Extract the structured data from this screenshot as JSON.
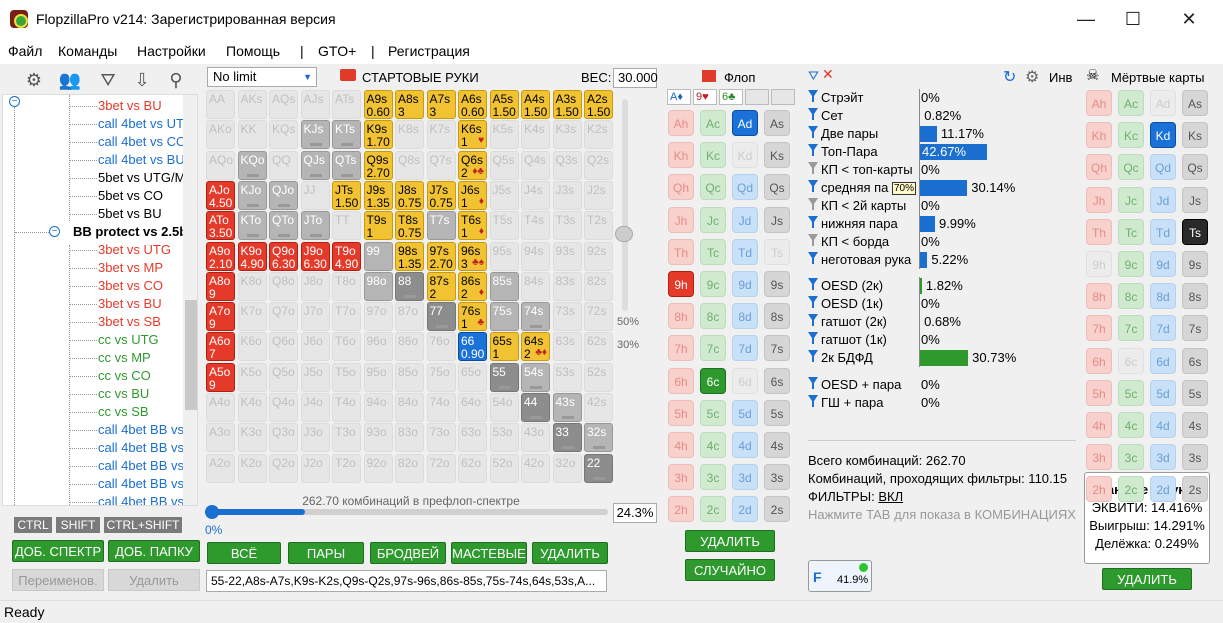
{
  "window": {
    "title": "FlopzillaPro v214: Зарегистрированная версия",
    "min": "—",
    "max": "☐",
    "close": "✕"
  },
  "menu": [
    "Файл",
    "Команды",
    "Настройки",
    "Помощь",
    "|",
    "GTO+",
    "|",
    "Регистрация"
  ],
  "tree": [
    {
      "label": "3bet vs BU",
      "color": "red"
    },
    {
      "label": "call 4bet vs UTG/",
      "color": "blue"
    },
    {
      "label": "call 4bet vs CO",
      "color": "blue"
    },
    {
      "label": "call 4bet vs BU",
      "color": "blue"
    },
    {
      "label": "5bet vs UTG/MP",
      "color": "black"
    },
    {
      "label": "5bet vs CO",
      "color": "black"
    },
    {
      "label": "5bet vs BU",
      "color": "black"
    },
    {
      "label": "BB protect vs 2.5bb",
      "color": "bold"
    },
    {
      "label": "3bet vs UTG",
      "color": "red"
    },
    {
      "label": "3bet vs MP",
      "color": "red"
    },
    {
      "label": "3bet vs CO",
      "color": "red"
    },
    {
      "label": "3bet vs BU",
      "color": "red"
    },
    {
      "label": "3bet vs SB",
      "color": "red"
    },
    {
      "label": "cc vs UTG",
      "color": "green"
    },
    {
      "label": "cc vs MP",
      "color": "green"
    },
    {
      "label": "cc vs CO",
      "color": "green"
    },
    {
      "label": "cc vs BU",
      "color": "green"
    },
    {
      "label": "cc vs SB",
      "color": "green"
    },
    {
      "label": "call 4bet BB vs U",
      "color": "blue"
    },
    {
      "label": "call 4bet BB vs M",
      "color": "blue"
    },
    {
      "label": "call 4bet BB vs C",
      "color": "blue"
    },
    {
      "label": "call 4bet BB vs B",
      "color": "blue"
    },
    {
      "label": "call 4bet BB vs S",
      "color": "blue"
    }
  ],
  "keys": {
    "ctrl": "CTRL",
    "shift": "SHIFT",
    "ctrlshift": "CTRL+SHIFT"
  },
  "leftbtns": {
    "add_range": "ДОБ. СПЕКТР",
    "add_folder": "ДОБ. ПАПКУ",
    "rename": "Переименов.",
    "delete": "Удалить"
  },
  "range": {
    "limit": "No limit",
    "title": "СТАРТОВЫЕ РУКИ",
    "weight_label": "ВЕС:",
    "weight": "30.000",
    "pct50": "50%",
    "pct30": "30%",
    "combos_text": "262.70 комбинаций в префлоп-спектре",
    "zero": "0%",
    "pct": "24.3%",
    "progress": 0.243,
    "text": "55-22,A8s-A7s,K9s-K2s,Q9s-Q2s,97s-96s,86s-85s,75s-74s,64s,53s,A..."
  },
  "rangebtns": {
    "all": "ВСЁ",
    "pairs": "ПАРЫ",
    "broadway": "БРОДВЕЙ",
    "suited": "МАСТЕВЫЕ",
    "delete": "УДАЛИТЬ"
  },
  "hand_weights": [
    {
      "hand": "A9s",
      "w": "0.60"
    },
    {
      "hand": "A8s",
      "w": "3"
    },
    {
      "hand": "A7s",
      "w": "3"
    },
    {
      "hand": "A6s",
      "w": "0.60"
    },
    {
      "hand": "A5s",
      "w": "1.50"
    },
    {
      "hand": "A4s",
      "w": "1.50"
    },
    {
      "hand": "A3s",
      "w": "1.50"
    },
    {
      "hand": "A2s",
      "w": "1.50"
    },
    {
      "hand": "K9s",
      "w": "1.70"
    },
    {
      "hand": "K6s",
      "w": "1"
    },
    {
      "hand": "Q9s",
      "w": "2.70"
    },
    {
      "hand": "Q6s",
      "w": "2"
    },
    {
      "hand": "AJo",
      "w": "4.50"
    },
    {
      "hand": "JTs",
      "w": "1.50"
    },
    {
      "hand": "J9s",
      "w": "1.35"
    },
    {
      "hand": "J8s",
      "w": "0.75"
    },
    {
      "hand": "J7s",
      "w": "0.75"
    },
    {
      "hand": "J6s",
      "w": "1"
    },
    {
      "hand": "ATo",
      "w": "3.50"
    },
    {
      "hand": "T9s",
      "w": "1"
    },
    {
      "hand": "T8s",
      "w": "0.75"
    },
    {
      "hand": "T6s",
      "w": "1"
    },
    {
      "hand": "A9o",
      "w": "2.10"
    },
    {
      "hand": "K9o",
      "w": "4.90"
    },
    {
      "hand": "Q9o",
      "w": "6.30"
    },
    {
      "hand": "J9o",
      "w": "6.30"
    },
    {
      "hand": "T9o",
      "w": "4.90"
    },
    {
      "hand": "98s",
      "w": "1.35"
    },
    {
      "hand": "97s",
      "w": "2.70"
    },
    {
      "hand": "96s",
      "w": "3"
    },
    {
      "hand": "A8o",
      "w": "9"
    },
    {
      "hand": "87s",
      "w": "2"
    },
    {
      "hand": "86s",
      "w": "2"
    },
    {
      "hand": "A7o",
      "w": "9"
    },
    {
      "hand": "76s",
      "w": "1"
    },
    {
      "hand": "A6o",
      "w": "7"
    },
    {
      "hand": "66",
      "w": "0.90"
    },
    {
      "hand": "65s",
      "w": "1"
    },
    {
      "hand": "64s",
      "w": "2"
    },
    {
      "hand": "A5o",
      "w": "9"
    }
  ],
  "flop": {
    "title": "Флоп",
    "s1": "A♦",
    "s2": "9♥",
    "s3": "6♣",
    "delete": "УДАЛИТЬ",
    "random": "СЛУЧАЙНО"
  },
  "filters": [
    {
      "label": "Стрэйт",
      "val": "0%",
      "pct": 0
    },
    {
      "label": "Сет",
      "val": "0.82%",
      "pct": 0.82
    },
    {
      "label": "Две пары",
      "val": "11.17%",
      "pct": 11.17
    },
    {
      "label": "Топ-Пара",
      "val": "42.67%",
      "pct": 42.67
    },
    {
      "label": "КП < топ-карты",
      "val": "0%",
      "pct": 0
    },
    {
      "label": "средняя па",
      "val": "30.14%",
      "pct": 30.14
    },
    {
      "label": "КП < 2й карты",
      "val": "0%",
      "pct": 0
    },
    {
      "label": "нижняя пара",
      "val": "9.99%",
      "pct": 9.99
    },
    {
      "label": "КП < борда",
      "val": "0%",
      "pct": 0
    },
    {
      "label": "неготовая рука",
      "val": "5.22%",
      "pct": 5.22
    }
  ],
  "draws": [
    {
      "label": "OESD (2к)",
      "val": "1.82%",
      "pct": 1.82
    },
    {
      "label": "OESD (1к)",
      "val": "0%",
      "pct": 0
    },
    {
      "label": "гатшот (2к)",
      "val": "0.68%",
      "pct": 0.68
    },
    {
      "label": "гатшот (1к)",
      "val": "0%",
      "pct": 0
    },
    {
      "label": "2к БДФД",
      "val": "30.73%",
      "pct": 30.73
    }
  ],
  "combo": [
    {
      "label": "OESD + пара",
      "val": "0%"
    },
    {
      "label": "ГШ + пара",
      "val": "0%"
    }
  ],
  "tooltip_70": "70%",
  "inv": "Инв",
  "stats": {
    "total": "Всего комбинаций: 262.70",
    "passing": "Комбинаций, проходящих фильтры: 110.15",
    "filters_label": "ФИЛЬТРЫ: ",
    "filters_val": "ВКЛ",
    "hint": "Нажмите TAB для показа в КОМБИНАЦИЯХ"
  },
  "fbadge": "41.9%",
  "dead": {
    "title": "Мёртвые карты",
    "delete": "УДАЛИТЬ"
  },
  "equity": {
    "title": "Данные о руке:",
    "eq": "ЭКВИТИ: 14.416%",
    "win": "Выигрыш: 14.291%",
    "tie": "Делёжка: 0.249%"
  },
  "status": "Ready",
  "colors": {
    "accent": "#1a6fd0",
    "green": "#2e9a2e",
    "red": "#e53a2a",
    "yellow": "#f1c232"
  }
}
